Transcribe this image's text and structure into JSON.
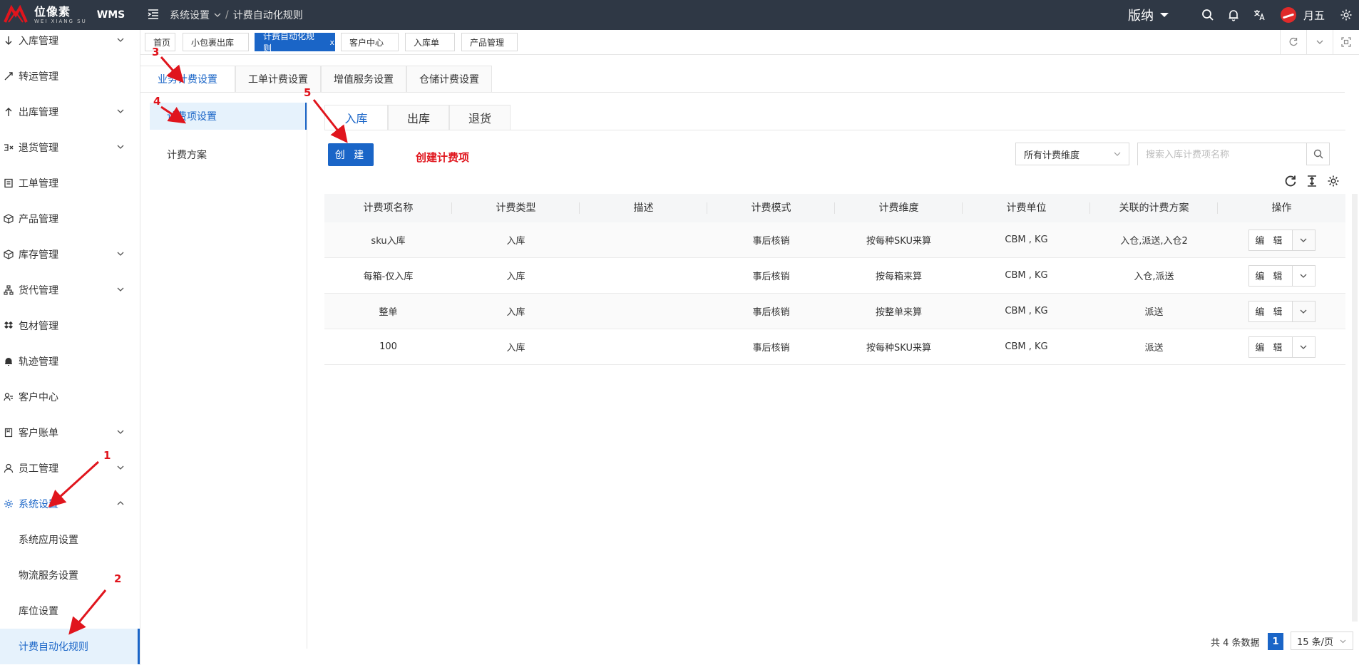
{
  "topbar": {
    "logo_cn": "位像素",
    "logo_en": "WEI XIANG SU",
    "logo_wms": "WMS",
    "breadcrumb": [
      "系统设置",
      "计费自动化规则"
    ],
    "edition": "版纳",
    "user": "月五",
    "icons": [
      "search-icon",
      "bell-icon",
      "translate-icon",
      "gear-icon"
    ]
  },
  "sidebar": {
    "items": [
      {
        "label": "入库管理",
        "icon": "arrow-down-icon",
        "expandable": true
      },
      {
        "label": "转运管理",
        "icon": "transfer-icon",
        "expandable": false
      },
      {
        "label": "出库管理",
        "icon": "arrow-up-icon",
        "expandable": true
      },
      {
        "label": "退货管理",
        "icon": "return-icon",
        "expandable": true
      },
      {
        "label": "工单管理",
        "icon": "ticket-icon",
        "expandable": false
      },
      {
        "label": "产品管理",
        "icon": "product-icon",
        "expandable": false
      },
      {
        "label": "库存管理",
        "icon": "box-icon",
        "expandable": true
      },
      {
        "label": "货代管理",
        "icon": "network-icon",
        "expandable": true
      },
      {
        "label": "包材管理",
        "icon": "dropbox-icon",
        "expandable": false
      },
      {
        "label": "轨迹管理",
        "icon": "bell-icon",
        "expandable": false
      },
      {
        "label": "客户中心",
        "icon": "customer-icon",
        "expandable": false
      },
      {
        "label": "客户账单",
        "icon": "bill-icon",
        "expandable": true
      },
      {
        "label": "员工管理",
        "icon": "user-icon",
        "expandable": true
      },
      {
        "label": "系统设置",
        "icon": "gear-icon",
        "expandable": true,
        "active": true
      }
    ],
    "subitems": [
      "系统应用设置",
      "物流服务设置",
      "库位设置",
      "计费自动化规则"
    ]
  },
  "page_tabs": [
    {
      "label": "首页"
    },
    {
      "label": "小包裹出库"
    },
    {
      "label": "计费自动化规则",
      "active": true,
      "close": "x"
    },
    {
      "label": "客户中心"
    },
    {
      "label": "入库单"
    },
    {
      "label": "产品管理"
    }
  ],
  "level1_tabs": [
    "业务计费设置",
    "工单计费设置",
    "增值服务设置",
    "仓储计费设置"
  ],
  "submenu": [
    "计费项设置",
    "计费方案"
  ],
  "level2_tabs": [
    "入库",
    "出库",
    "退货"
  ],
  "toolbar": {
    "create_label": "创 建",
    "note": "创建计费项",
    "dimension_select": "所有计费维度",
    "search_placeholder": "搜索入库计费项名称"
  },
  "table": {
    "headers": [
      "计费项名称",
      "计费类型",
      "描述",
      "计费模式",
      "计费维度",
      "计费单位",
      "关联的计费方案",
      "操作"
    ],
    "rows": [
      {
        "name": "sku入库",
        "type": "入库",
        "desc": "",
        "mode": "事后核销",
        "dimension": "按每种SKU来算",
        "unit": "CBM , KG",
        "plans": "入仓,派送,入仓2"
      },
      {
        "name": "每箱-仅入库",
        "type": "入库",
        "desc": "",
        "mode": "事后核销",
        "dimension": "按每箱来算",
        "unit": "CBM , KG",
        "plans": "入仓,派送"
      },
      {
        "name": "整单",
        "type": "入库",
        "desc": "",
        "mode": "事后核销",
        "dimension": "按整单来算",
        "unit": "CBM , KG",
        "plans": "派送"
      },
      {
        "name": "100",
        "type": "入库",
        "desc": "",
        "mode": "事后核销",
        "dimension": "按每种SKU来算",
        "unit": "CBM , KG",
        "plans": "派送"
      }
    ],
    "edit_label": "编 辑"
  },
  "pagination": {
    "total": "共 4 条数据",
    "current": "1",
    "page_size": "15 条/页"
  },
  "annotations": [
    "1",
    "2",
    "3",
    "4",
    "5"
  ],
  "colors": {
    "primary": "#1a65c7",
    "topbar": "#2f3845",
    "annotation": "#e0151d"
  }
}
